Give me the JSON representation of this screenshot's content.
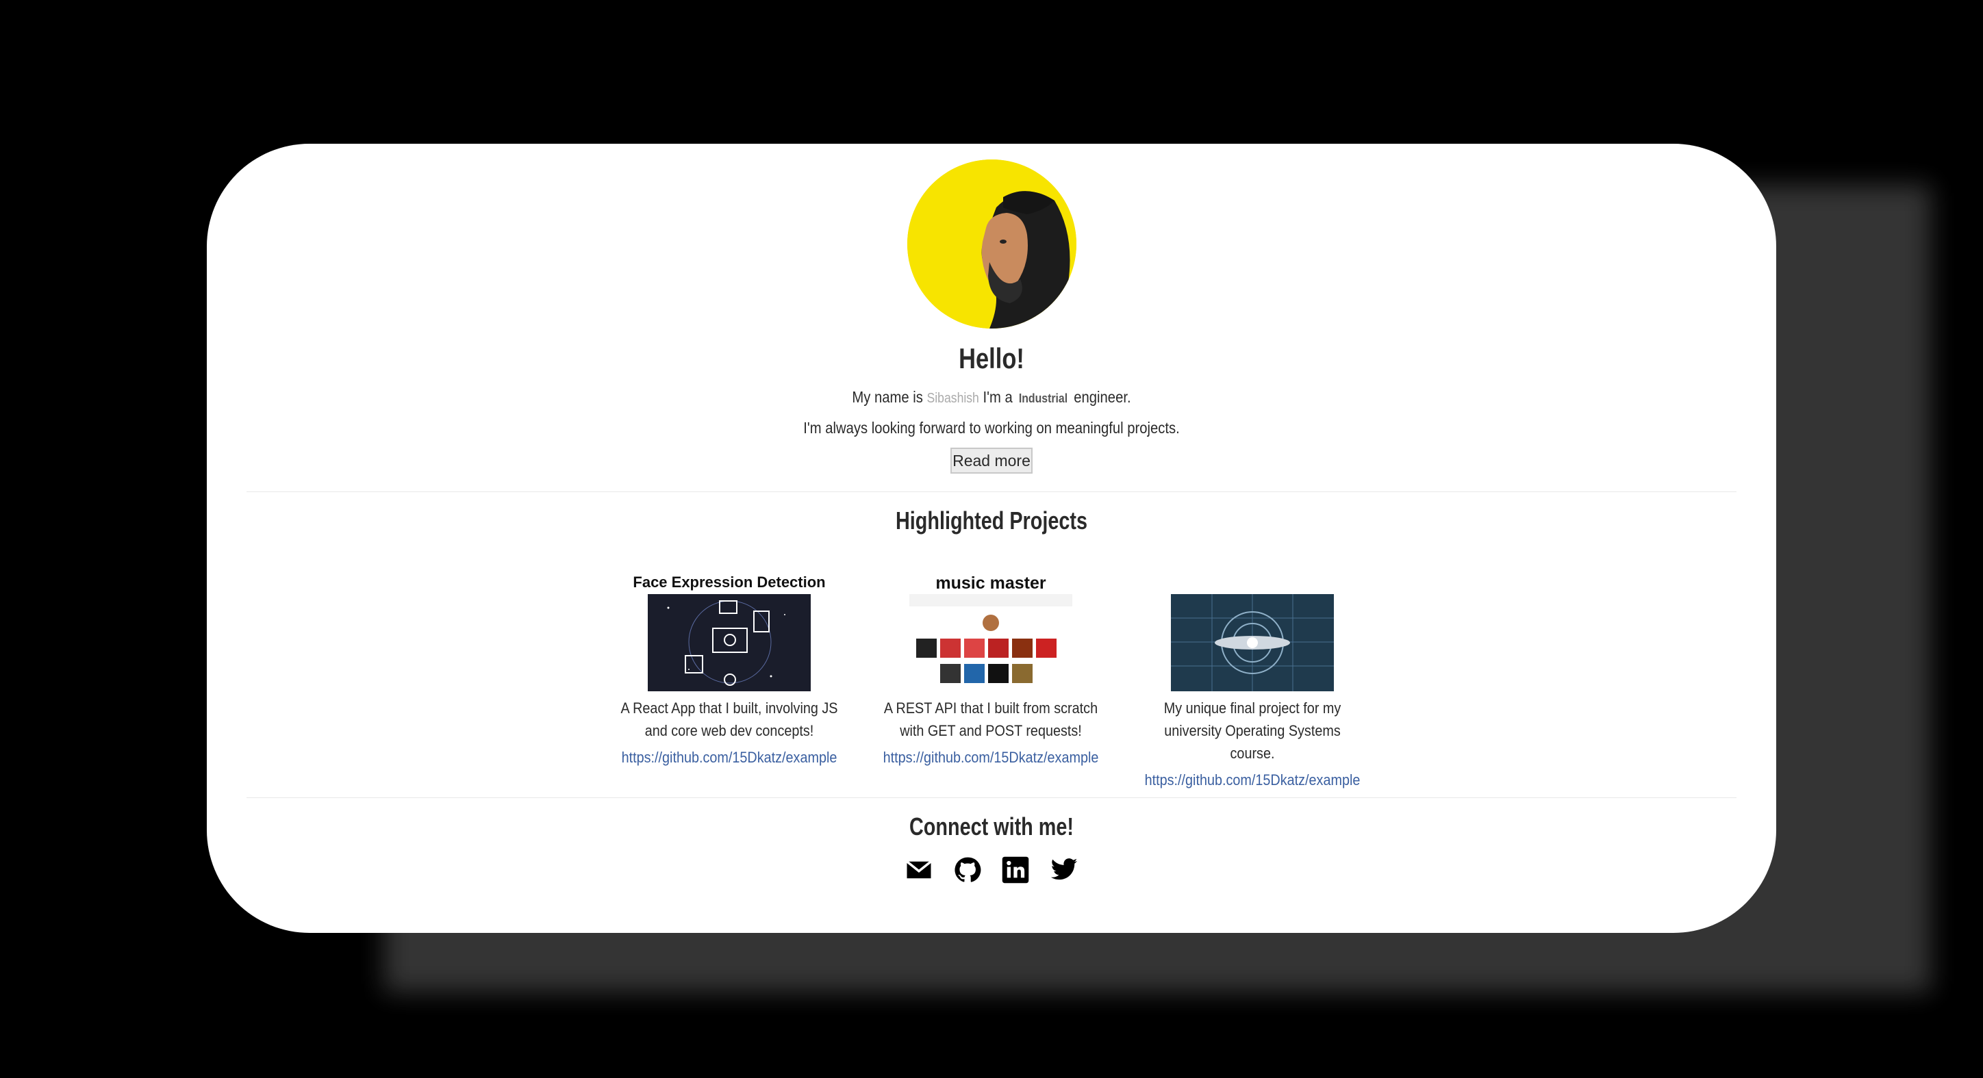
{
  "hero": {
    "greeting": "Hello!",
    "intro_prefix": "My name is",
    "name": "Sibashish",
    "intro_middle": "I'm a",
    "profession": "Industrial",
    "intro_suffix": "engineer.",
    "tagline": "I'm always looking forward to working on meaningful projects.",
    "read_more_label": "Read more",
    "avatar_bg": "#f7e400"
  },
  "projects": {
    "title": "Highlighted Projects",
    "items": [
      {
        "title": "Face Expression Detection",
        "desc_line1": "A React App that I built, involving JS",
        "desc_line2": "and core web dev concepts!",
        "link": "https://github.com/15Dkatz/example"
      },
      {
        "title": "music master",
        "desc_line1": "A REST API that I built from scratch",
        "desc_line2": "with GET and POST requests!",
        "link": "https://github.com/15Dkatz/example"
      },
      {
        "title": "",
        "desc_line1": "My unique final project for my",
        "desc_line2": "university Operating Systems course.",
        "link": "https://github.com/15Dkatz/example"
      }
    ]
  },
  "connect": {
    "title": "Connect with me!",
    "icons": [
      "email-icon",
      "github-icon",
      "linkedin-icon",
      "twitter-icon"
    ]
  }
}
